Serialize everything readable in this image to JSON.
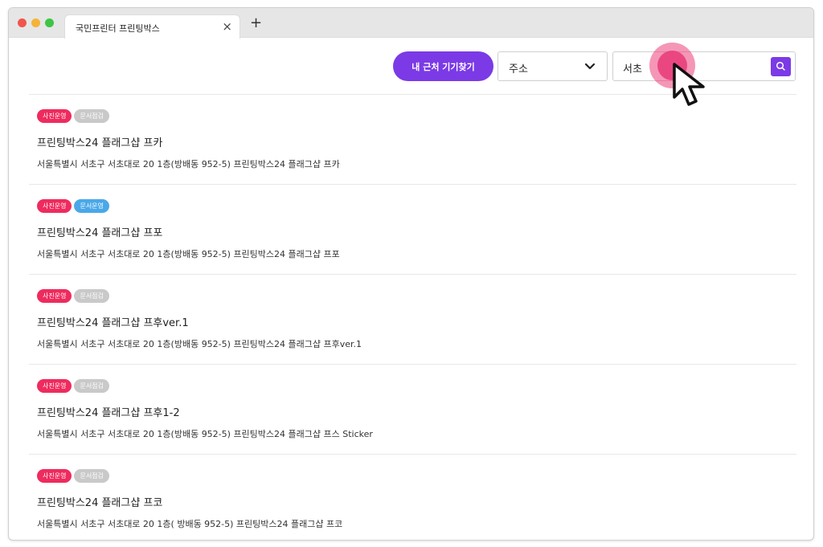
{
  "browser": {
    "tab_title": "국민프린터 프린팅박스",
    "close_symbol": "×",
    "new_tab_symbol": "+"
  },
  "toolbar": {
    "nearby_button_label": "내 근처 기기찾기",
    "select_value": "주소",
    "search_value": "서초"
  },
  "colors": {
    "accent": "#7b3ae6",
    "badge_active_photo": "#ef2b5e",
    "badge_active_doc": "#4aa8e8",
    "badge_inactive": "#c9c9c9",
    "touch_highlight": "#e7447a"
  },
  "results": [
    {
      "badges": [
        {
          "label": "사진운영",
          "active": true
        },
        {
          "label": "문서점검",
          "active": false
        }
      ],
      "title": "프린팅박스24 플래그샵 프카",
      "address": "서울특별시 서초구 서초대로 20 1층(방배동 952-5) 프린팅박스24 플래그샵 프카"
    },
    {
      "badges": [
        {
          "label": "사진운영",
          "active": true
        },
        {
          "label": "문서운영",
          "active": true
        }
      ],
      "title": "프린팅박스24 플래그샵 프포",
      "address": "서울특별시 서초구 서초대로 20 1층(방배동 952-5) 프린팅박스24 플래그샵 프포"
    },
    {
      "badges": [
        {
          "label": "사진운영",
          "active": true
        },
        {
          "label": "문서점검",
          "active": false
        }
      ],
      "title": "프린팅박스24 플래그샵 프후ver.1",
      "address": "서울특별시 서초구 서초대로 20 1층(방배동 952-5) 프린팅박스24 플래그샵 프후ver.1"
    },
    {
      "badges": [
        {
          "label": "사진운영",
          "active": true
        },
        {
          "label": "문서점검",
          "active": false
        }
      ],
      "title": "프린팅박스24 플래그샵 프후1-2",
      "address": "서울특별시 서초구 서초대로 20 1층(방배동 952-5) 프린팅박스24 플래그샵 프스 Sticker"
    },
    {
      "badges": [
        {
          "label": "사진운영",
          "active": true
        },
        {
          "label": "문서점검",
          "active": false
        }
      ],
      "title": "프린팅박스24 플래그샵 프코",
      "address": "서울특별시 서초구 서초대로 20 1층( 방배동 952-5) 프린팅박스24 플래그샵 프코"
    }
  ]
}
